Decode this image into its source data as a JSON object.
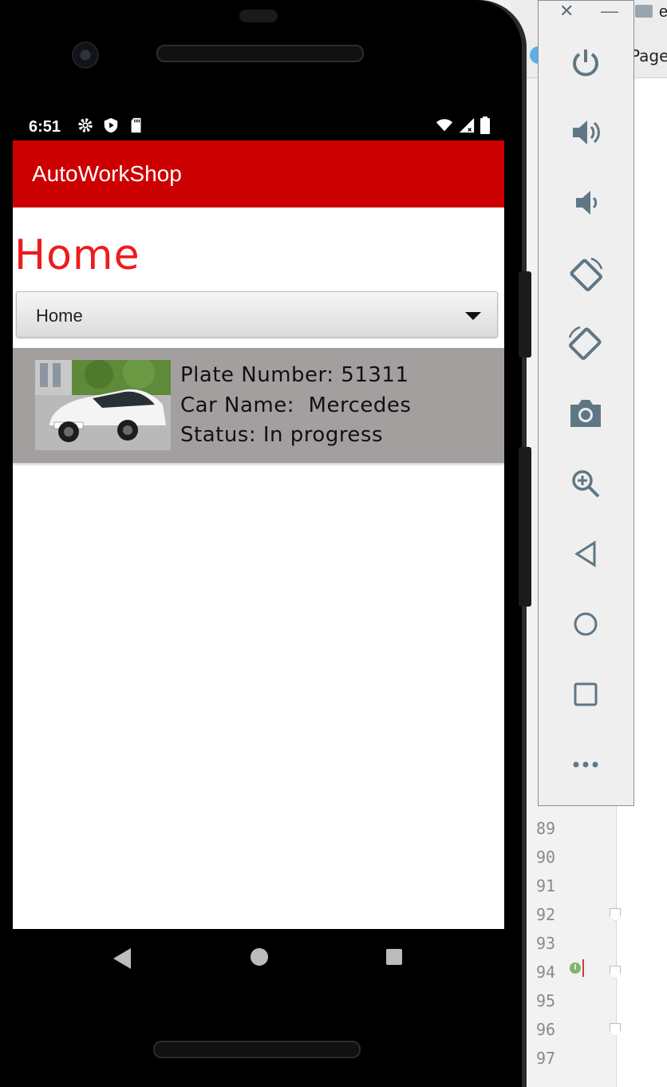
{
  "status_bar": {
    "time": "6:51"
  },
  "app_bar": {
    "title": "AutoWorkShop"
  },
  "page": {
    "heading": "Home"
  },
  "spinner": {
    "selected": "Home"
  },
  "car_list": [
    {
      "plate_line": "Plate Number: 51311",
      "name_line": "Car Name:  Mercedes",
      "status_line": "Status: In progress"
    }
  ],
  "ide": {
    "tab_label": "Page",
    "tab_prefix": "e",
    "line_numbers": [
      "89",
      "90",
      "91",
      "92",
      "93",
      "94",
      "95",
      "96",
      "97"
    ]
  },
  "colors": {
    "app_bar": "#cc0000",
    "heading": "#ee1c1c",
    "list_item_bg": "#a39f9e"
  },
  "emulator_controls": [
    "close-icon",
    "minimize-icon",
    "power-icon",
    "volume-up-icon",
    "volume-down-icon",
    "rotate-left-icon",
    "rotate-right-icon",
    "camera-icon",
    "zoom-icon",
    "back-icon",
    "home-icon",
    "overview-icon",
    "more-icon"
  ]
}
